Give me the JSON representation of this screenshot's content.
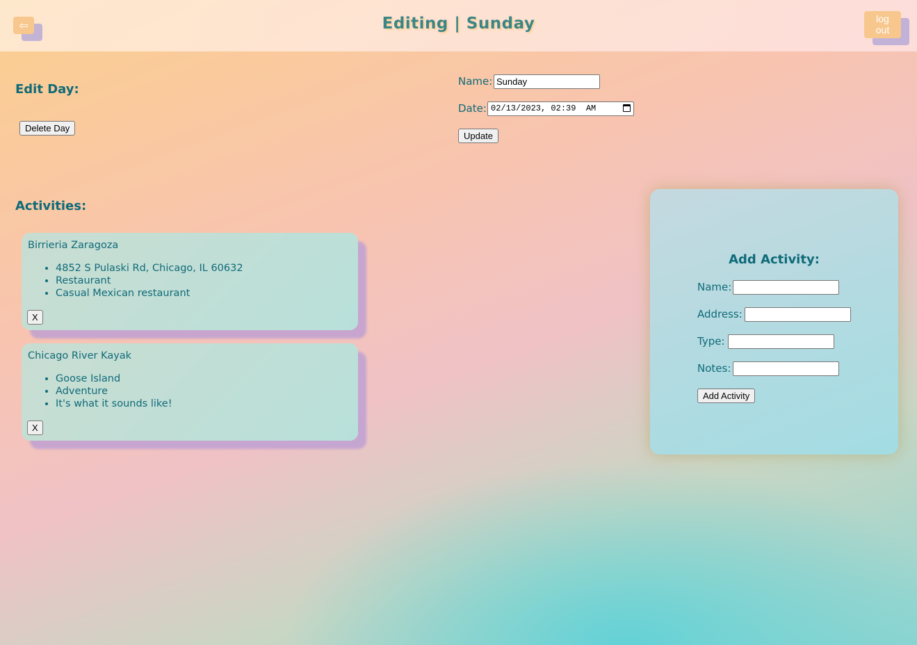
{
  "header": {
    "back_icon": "arrow-left-icon",
    "back_glyph": "⇦",
    "title": "Editing | Sunday",
    "logout_line1": "log",
    "logout_line2": "out"
  },
  "edit_day": {
    "heading": "Edit Day:",
    "delete_label": "Delete Day",
    "name_label": "Name:",
    "name_value": "Sunday",
    "date_label": "Date:",
    "date_value": "02/13/2023, 02:39  AM",
    "update_label": "Update"
  },
  "activities": {
    "heading": "Activities:",
    "items": [
      {
        "name": "Birrieria Zaragoza",
        "details": [
          "4852 S Pulaski Rd, Chicago, IL 60632",
          "Restaurant",
          "Casual Mexican restaurant"
        ],
        "remove_label": "X"
      },
      {
        "name": "Chicago River Kayak",
        "details": [
          "Goose Island",
          "Adventure",
          "It's what it sounds like!"
        ],
        "remove_label": "X"
      }
    ]
  },
  "add_activity": {
    "heading": "Add Activity:",
    "name_label": "Name:",
    "address_label": "Address:",
    "type_label": "Type:",
    "notes_label": "Notes:",
    "submit_label": "Add Activity"
  },
  "colors": {
    "text_teal": "#0f6a78",
    "title_teal": "#3d8585",
    "button_peach": "#f7c78d",
    "shadow_lavender": "#b9aad7"
  }
}
